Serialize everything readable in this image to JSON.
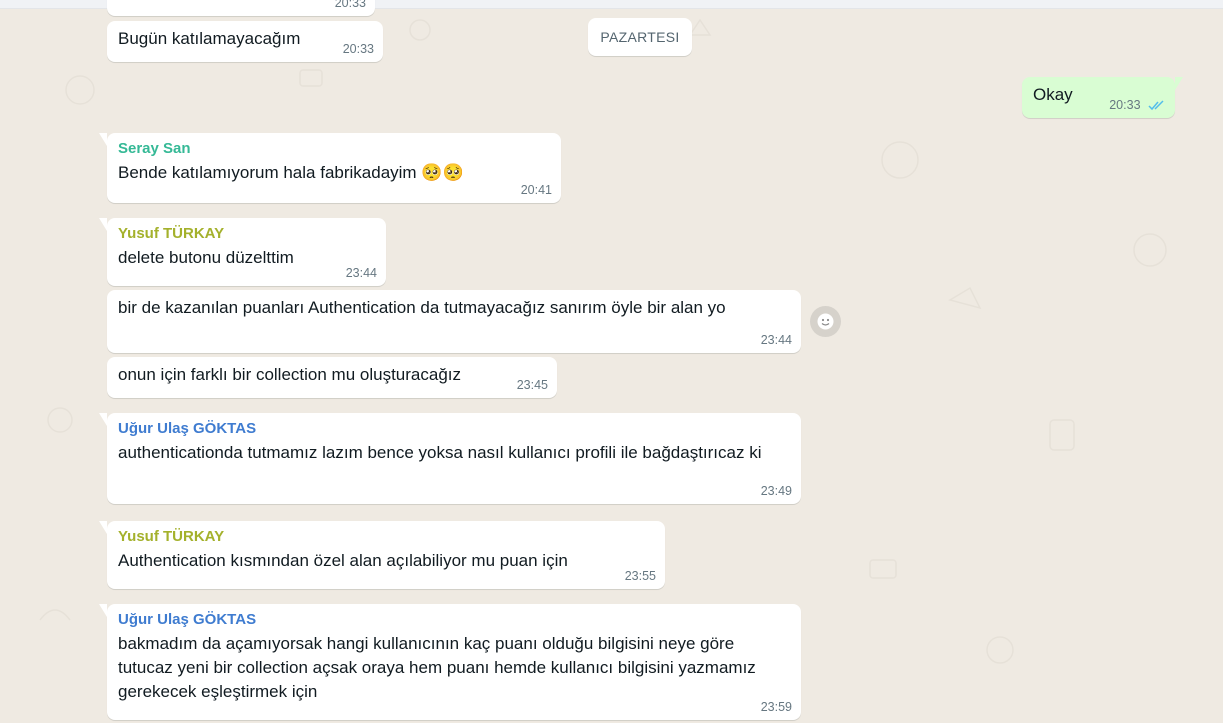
{
  "day_separator": "PAZARTESI",
  "colors": {
    "background": "#efeae2",
    "incoming_bubble": "#ffffff",
    "outgoing_bubble": "#d9fdd3",
    "timestamp": "#667781",
    "read_ticks": "#53bdeb",
    "sender_seray": "#35b996",
    "sender_yusuf": "#a4b12c",
    "sender_ugur": "#3f7cd0"
  },
  "partial_top_time": "20:33",
  "messages": [
    {
      "text": "Bugün katılamayacağım",
      "time": "20:33"
    },
    {
      "text": "Okay",
      "time": "20:33",
      "status": "read"
    },
    {
      "sender": "Seray San",
      "text": "Bende katılamıyorum hala fabrikadayim",
      "emoji": "🥺🥺",
      "time": "20:41"
    },
    {
      "sender": "Yusuf TÜRKAY",
      "text": "delete butonu düzelttim",
      "time": "23:44"
    },
    {
      "text": "bir de kazanılan puanları Authentication da tutmayacağız sanırım öyle bir alan yo",
      "time": "23:44"
    },
    {
      "text": "onun için farklı bir collection mu oluşturacağız",
      "time": "23:45"
    },
    {
      "sender": "Uğur Ulaş GÖKTAS",
      "text": "authenticationda tutmamız lazım bence yoksa nasıl kullanıcı profili ile bağdaştırıcaz ki",
      "time": "23:49"
    },
    {
      "sender": "Yusuf TÜRKAY",
      "text": "Authentication kısmından özel alan açılabiliyor mu puan için",
      "time": "23:55"
    },
    {
      "sender": "Uğur Ulaş GÖKTAS",
      "text": "bakmadım da açamıyorsak hangi kullanıcının kaç puanı olduğu bilgisini neye göre tutucaz yeni bir collection açsak oraya hem puanı hemde kullanıcı bilgisini yazmamız gerekecek eşleştirmek için",
      "time": "23:59"
    }
  ]
}
